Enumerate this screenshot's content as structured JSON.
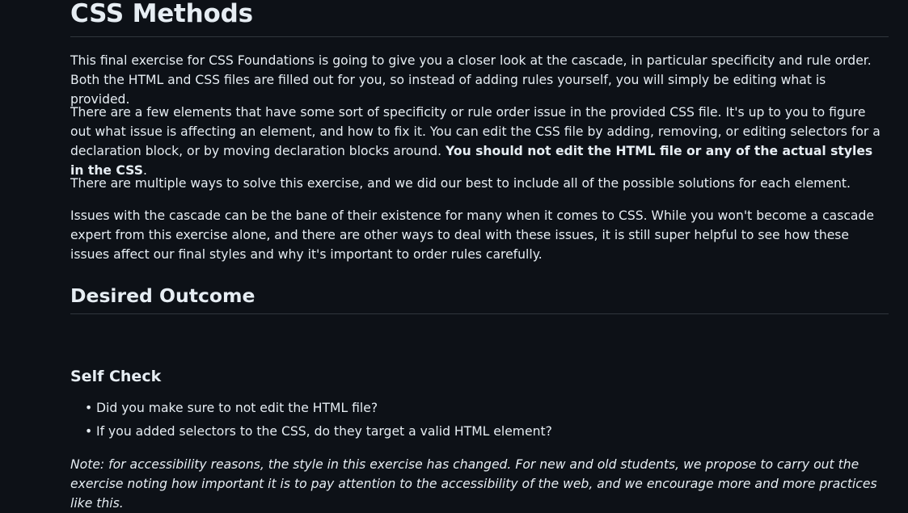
{
  "page": {
    "title": "CSS Methods"
  },
  "intro": {
    "p1": "This final exercise for CSS Foundations is going to give you a closer look at the cascade, in particular specificity and rule order. Both the HTML and CSS files are filled out for you, so instead of adding rules yourself, you will simply be editing what is provided.",
    "p2_text": "There are a few elements that have some sort of specificity or rule order issue in the provided CSS file. It's up to you to figure out what issue is affecting an element, and how to fix it. You can edit the CSS file by adding, removing, or editing selectors for a declaration block, or by moving declaration blocks around. ",
    "p2_bold": "You should not edit the HTML file or any of the actual styles in the CSS",
    "p2_end": ".",
    "p3": "There are multiple ways to solve this exercise, and we did our best to include all of the possible solutions for each element.",
    "p4": "Issues with the cascade can be the bane of their existence for many when it comes to CSS. While you won't become a cascade expert from this exercise alone, and there are other ways to deal with these issues, it is still super helpful to see how these issues affect our final styles and why it's important to order rules carefully."
  },
  "desired_outcome": {
    "title": "Desired Outcome"
  },
  "self_check": {
    "title": "Self Check",
    "bullet": "•",
    "items": [
      "Did you make sure to not edit the HTML file?",
      "If you added selectors to the CSS, do they target a valid HTML element?"
    ]
  },
  "note": "Note: for accessibility reasons, the style in this exercise has changed. For new and old students, we propose to carry out the exercise noting how important it is to pay attention to the accessibility of the web, and we encourage more and more practices like this."
}
